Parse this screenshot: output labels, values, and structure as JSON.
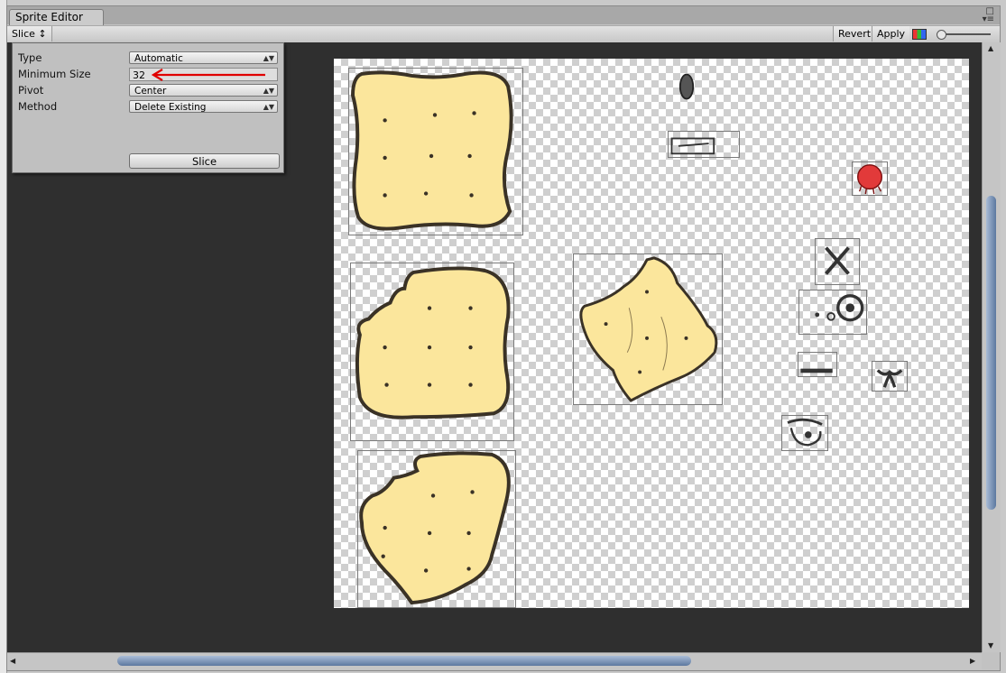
{
  "window": {
    "tab_title": "Sprite Editor",
    "menu_icon": "context-menu-icon"
  },
  "toolbar": {
    "slice_label": "Slice ↕",
    "revert_label": "Revert",
    "apply_label": "Apply",
    "color_icon": "rgb-channel-icon",
    "zoom_icon": "zoom-slider",
    "zoom_level": 0.05
  },
  "slice_panel": {
    "type_label": "Type",
    "type_value": "Automatic",
    "min_size_label": "Minimum Size",
    "min_size_value": "32",
    "pivot_label": "Pivot",
    "pivot_value": "Center",
    "method_label": "Method",
    "method_value": "Delete Existing",
    "slice_button": "Slice"
  },
  "annotation": {
    "arrow_color": "#e00000"
  },
  "sprites": [
    "cracker-square",
    "cracker-bitten",
    "cracker-bitten-2",
    "cracker-broken",
    "oval-seed",
    "pencil-stroke",
    "red-ball",
    "x-mark",
    "eye-dots",
    "dash-bar",
    "claw-mark",
    "eye-sketch"
  ],
  "colors": {
    "cracker_fill": "#fbe69c",
    "cracker_outline": "#3a3226",
    "panel_bg": "#c0c0c0",
    "viewport_bg": "#2f2f2f"
  }
}
